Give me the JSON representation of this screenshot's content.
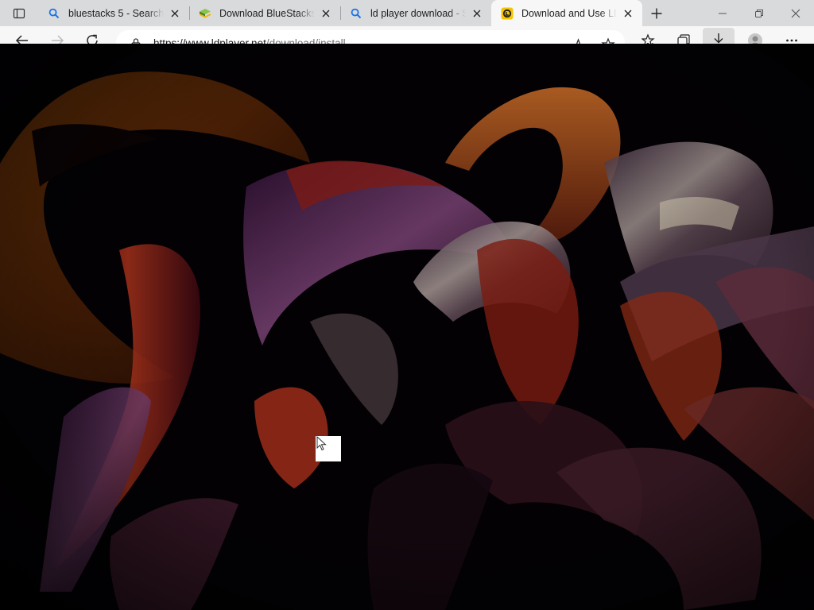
{
  "tabs": [
    {
      "title": "bluestacks 5 - Search",
      "icon": "search-icon",
      "active": false
    },
    {
      "title": "Download BlueStacks -",
      "icon": "bluestacks-icon",
      "active": false
    },
    {
      "title": "ld player download - S",
      "icon": "search-icon",
      "active": false
    },
    {
      "title": "Download and Use LDP",
      "icon": "ldplayer-icon",
      "active": true
    }
  ],
  "address_bar": {
    "url_host": "https://www.ldplayer.net",
    "url_path": "/download/install"
  },
  "colors": {
    "tabstrip_bg": "#d8dadc",
    "active_tab_bg": "#f7f7f7",
    "search_icon": "#1a73e8",
    "ldplayer_yellow": "#f5c400",
    "content_bg": "#020103"
  }
}
